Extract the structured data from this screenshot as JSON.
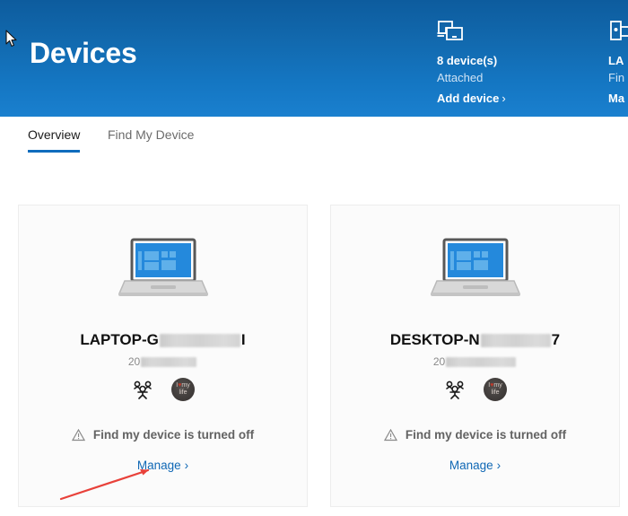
{
  "header": {
    "title": "Devices",
    "cursor_icon": "mouse-pointer-icon",
    "summaries": [
      {
        "icon": "devices-icon",
        "count": "8 device(s)",
        "sub": "Attached",
        "link": "Add device",
        "chevron": "›"
      },
      {
        "icon": "device-phone-icon",
        "count": "LA",
        "sub": "Fin",
        "link": "Ma",
        "chevron": ""
      }
    ],
    "gradient_top": "#0d5c9e",
    "gradient_bottom": "#1a80cf"
  },
  "tabs": [
    {
      "label": "Overview",
      "active": true
    },
    {
      "label": "Find My Device",
      "active": false
    }
  ],
  "accent_color": "#0f6cbd",
  "link_color": "#1068b5",
  "cards": [
    {
      "art_icon": "laptop-icon",
      "name_prefix": "LAPTOP-G",
      "name_suffix": "I",
      "sub_prefix": "20",
      "sub_suffix": "",
      "family_icon": "family-people-icon",
      "avatar_icon": "user-avatar",
      "avatar_line1": "I",
      "avatar_heart": "♥",
      "avatar_line1b": "my",
      "avatar_line2": "life",
      "warning_icon": "warning-triangle-icon",
      "status": "Find my device is turned off",
      "manage": "Manage",
      "chevron": "›"
    },
    {
      "art_icon": "laptop-icon",
      "name_prefix": "DESKTOP-N",
      "name_suffix": "7",
      "sub_prefix": "20",
      "sub_suffix": "",
      "family_icon": "family-people-icon",
      "avatar_icon": "user-avatar",
      "avatar_line1": "I",
      "avatar_heart": "♥",
      "avatar_line1b": "my",
      "avatar_line2": "life",
      "warning_icon": "warning-triangle-icon",
      "status": "Find my device is turned off",
      "manage": "Manage",
      "chevron": "›"
    }
  ],
  "annotation": {
    "arrow_color": "#e8413a",
    "points_to": "Manage"
  }
}
